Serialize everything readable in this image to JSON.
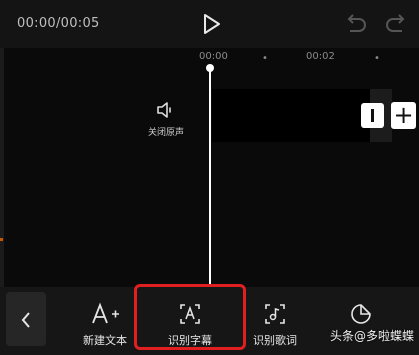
{
  "header": {
    "time_display": "00:00/00:05",
    "play_icon": "play-icon",
    "undo_icon": "undo-icon",
    "redo_icon": "redo-icon"
  },
  "timeline": {
    "ticks": [
      "00:00",
      "00:02"
    ]
  },
  "audio": {
    "mute_icon": "speaker-icon",
    "mute_label": "关闭原声"
  },
  "toolbar": {
    "back_icon": "chevron-left-icon",
    "tools": [
      {
        "label": "新建文本",
        "icon": "add-text-icon"
      },
      {
        "label": "识别字幕",
        "icon": "recognize-subtitle-icon"
      },
      {
        "label": "识别歌词",
        "icon": "recognize-lyrics-icon"
      },
      {
        "label": "",
        "icon": "sticker-icon"
      }
    ],
    "highlight_color": "#e02020"
  },
  "watermark": "头条@多啦蝶蝶"
}
